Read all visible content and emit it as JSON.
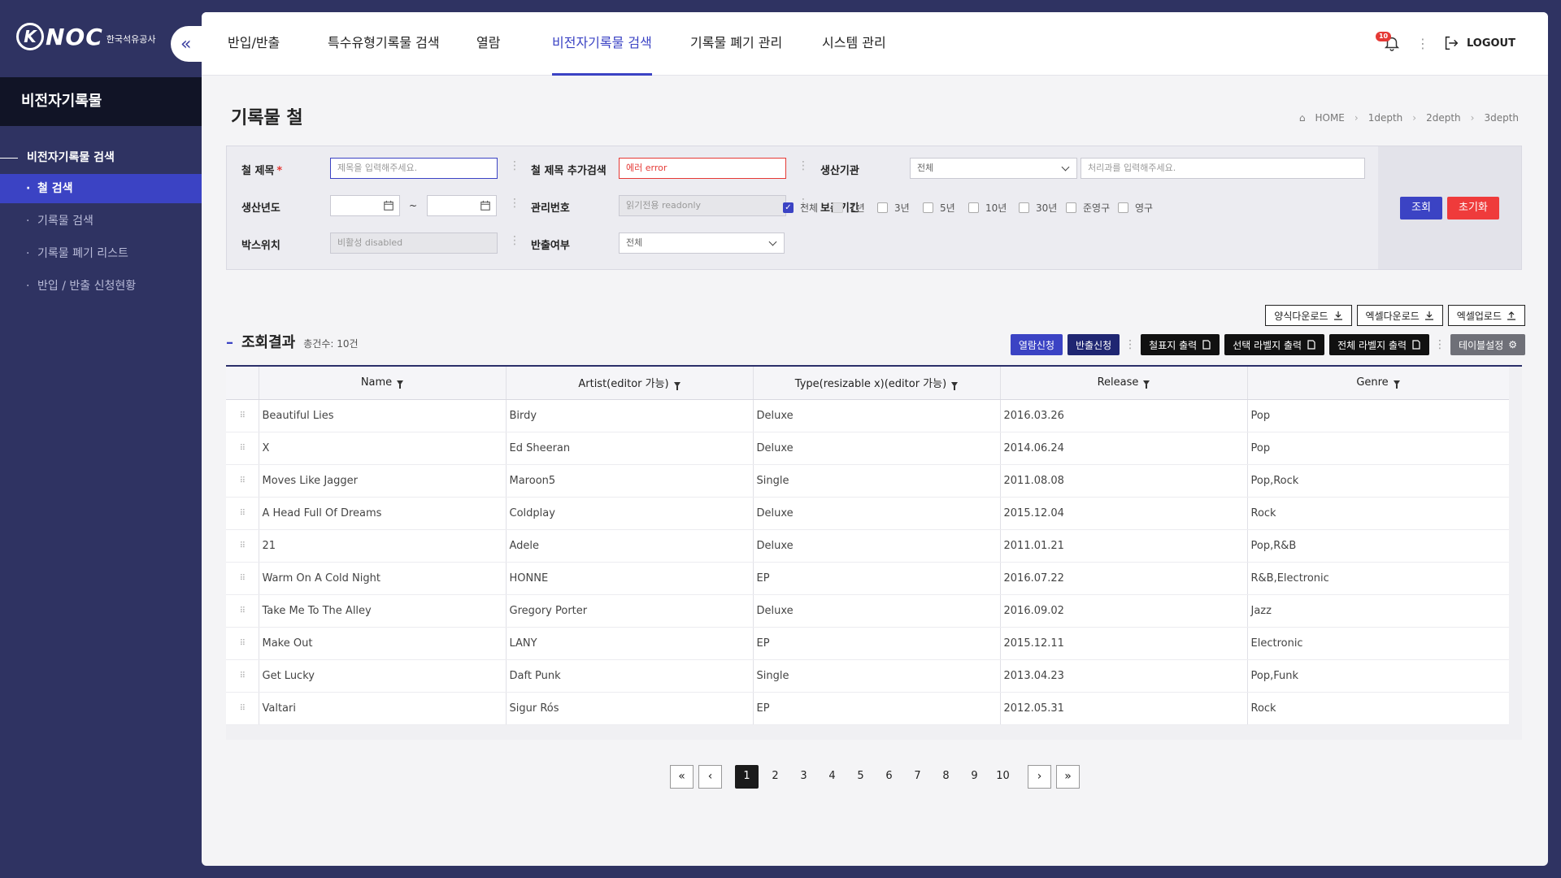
{
  "brand": {
    "mark": "K",
    "name": "NOC",
    "sub": "한국석유공사"
  },
  "sidebar": {
    "title": "비전자기록물",
    "group": "비전자기록물 검색",
    "items": [
      {
        "label": "철 검색",
        "active": true
      },
      {
        "label": "기록물 검색"
      },
      {
        "label": "기록물 폐기 리스트"
      },
      {
        "label": "반입 / 반출 신청현황"
      }
    ]
  },
  "nav": {
    "items": [
      "반입/반출",
      "특수유형기록물 검색",
      "열람",
      "비전자기록물 검색",
      "기록물 폐기 관리",
      "시스템 관리"
    ],
    "active_index": 3,
    "badge": "10",
    "logout": "LOGOUT"
  },
  "page": {
    "title": "기록물 철",
    "breadcrumb": [
      "HOME",
      "1depth",
      "2depth",
      "3depth"
    ]
  },
  "search": {
    "title_label": "철 제목",
    "title_placeholder": "제목을 입력해주세요.",
    "extra_label": "철 제목 추가검색",
    "extra_value": "에러 error",
    "org_label": "생산기관",
    "org_select": "전체",
    "org_placeholder": "처리과를 입력해주세요.",
    "year_label": "생산년도",
    "tilde": "~",
    "mgmt_label": "관리번호",
    "mgmt_value": "읽기전용 readonly",
    "retention_label": "보존기간",
    "retention_options": [
      {
        "label": "전체",
        "state": "checked"
      },
      {
        "label": "1년",
        "state": "disabled"
      },
      {
        "label": "3년",
        "state": "off"
      },
      {
        "label": "5년",
        "state": "off"
      },
      {
        "label": "10년",
        "state": "off"
      },
      {
        "label": "30년",
        "state": "off"
      },
      {
        "label": "준영구",
        "state": "off"
      },
      {
        "label": "영구",
        "state": "off"
      }
    ],
    "box_label": "박스위치",
    "box_value": "비활성 disabled",
    "export_label": "반출여부",
    "export_select": "전체",
    "btn_search": "조회",
    "btn_reset": "초기화"
  },
  "results": {
    "title": "조회결과",
    "count": "총건수: 10건",
    "toolbar_top": [
      "양식다운로드",
      "엑셀다운로드",
      "엑셀업로드"
    ],
    "btn_view": "열람신청",
    "btn_export": "반출신청",
    "btn_cover": "철표지 출력",
    "btn_sel_label": "선택 라벨지 출력",
    "btn_all_label": "전체 라벨지 출력",
    "btn_table_setting": "테이블설정"
  },
  "table": {
    "columns": [
      "Name",
      "Artist(editor 가능)",
      "Type(resizable x)(editor 가능)",
      "Release",
      "Genre"
    ],
    "rows": [
      [
        "Beautiful Lies",
        "Birdy",
        "Deluxe",
        "2016.03.26",
        "Pop"
      ],
      [
        "X",
        "Ed Sheeran",
        "Deluxe",
        "2014.06.24",
        "Pop"
      ],
      [
        "Moves Like Jagger",
        "Maroon5",
        "Single",
        "2011.08.08",
        "Pop,Rock"
      ],
      [
        "A Head Full Of Dreams",
        "Coldplay",
        "Deluxe",
        "2015.12.04",
        "Rock"
      ],
      [
        "21",
        "Adele",
        "Deluxe",
        "2011.01.21",
        "Pop,R&B"
      ],
      [
        "Warm On A Cold Night",
        "HONNE",
        "EP",
        "2016.07.22",
        "R&B,Electronic"
      ],
      [
        "Take Me To The Alley",
        "Gregory Porter",
        "Deluxe",
        "2016.09.02",
        "Jazz"
      ],
      [
        "Make Out",
        "LANY",
        "EP",
        "2015.12.11",
        "Electronic"
      ],
      [
        "Get Lucky",
        "Daft Punk",
        "Single",
        "2013.04.23",
        "Pop,Funk"
      ],
      [
        "Valtari",
        "Sigur Rós",
        "EP",
        "2012.05.31",
        "Rock"
      ]
    ]
  },
  "pagination": {
    "pages": [
      "1",
      "2",
      "3",
      "4",
      "5",
      "6",
      "7",
      "8",
      "9",
      "10"
    ],
    "current": 1,
    "first": "«",
    "prev": "‹",
    "next": "›",
    "last": "»"
  },
  "colors": {
    "accent": "#3b43c4",
    "danger": "#ef3b3b",
    "sidebar": "#2f3362"
  }
}
